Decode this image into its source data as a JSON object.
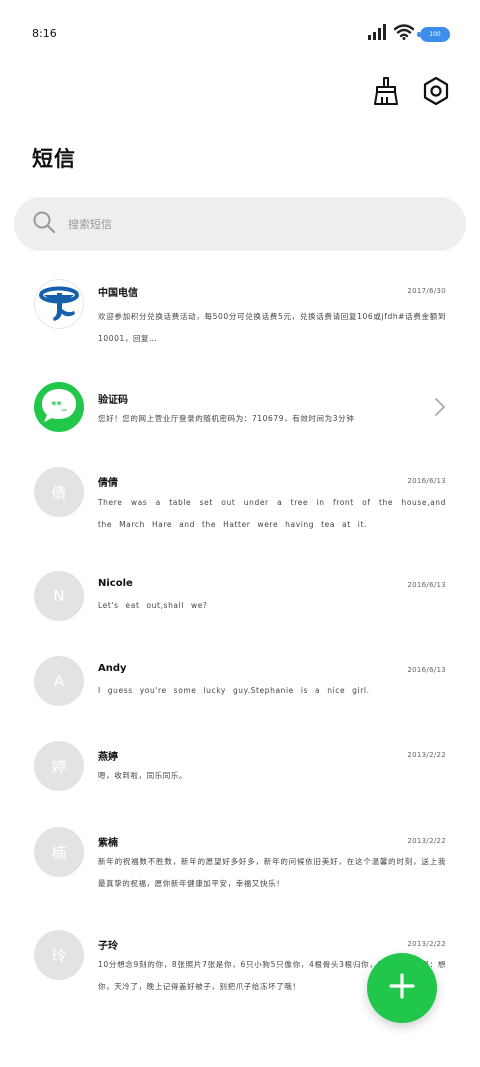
{
  "status_bar": {
    "time": "8:16",
    "battery_label": "100",
    "icons": [
      "signal-icon",
      "wifi-icon",
      "battery-icon"
    ]
  },
  "toolbar": {
    "icons": [
      "broom-icon",
      "settings-icon"
    ]
  },
  "page_title": "短信",
  "search": {
    "placeholder": "搜索短信",
    "icon": "search-icon"
  },
  "threads": [
    {
      "name": "中国电信",
      "date": "2017/6/30",
      "preview": "欢迎参加积分兑换话费活动，每500分可兑换话费5元，兑换话费请回复106或jfdh#话费金额到10001，回复…",
      "avatar_text": "",
      "avatar_icon": "china-telecom-logo"
    },
    {
      "name": "验证码",
      "date": "",
      "preview": "您好！您的网上营业厅登录的随机密码为：710679，有效时间为3分钟",
      "avatar_text": "",
      "avatar_icon": "message-icon"
    },
    {
      "name": "倩倩",
      "date": "2016/6/13",
      "preview": "There was a table set out under a tree in front of the house,and the March Hare and the Hatter were having tea at it.",
      "avatar_text": "倩"
    },
    {
      "name": "Nicole",
      "date": "2016/6/13",
      "preview": "Let's eat out,shall we?",
      "avatar_text": "N"
    },
    {
      "name": "Andy",
      "date": "2016/6/13",
      "preview": "I guess you're some lucky guy.Stephanie is a nice girl.",
      "avatar_text": "A"
    },
    {
      "name": "燕婷",
      "date": "2013/2/22",
      "preview": "嗯，收到啦，同乐同乐。",
      "avatar_text": "婷"
    },
    {
      "name": "紫楠",
      "date": "2013/2/22",
      "preview": "新年的祝福数不胜数，新年的愿望好多好多，新年的问候依旧美好，在这个温馨的时刻，送上我最真挚的祝福，愿你新年健康加平安，幸福又快乐！",
      "avatar_text": "楠"
    },
    {
      "name": "子玲",
      "date": "2013/2/22",
      "preview": "10分想念9刻的你，8张照片7张是你，6只小狗5只像你，4根骨头3根归你，2句实话1句是：想你，天冷了，晚上记得盖好被子，别把爪子给冻坏了哦！",
      "avatar_text": "玲"
    }
  ],
  "fab": {
    "icon": "plus-icon",
    "label": ""
  }
}
